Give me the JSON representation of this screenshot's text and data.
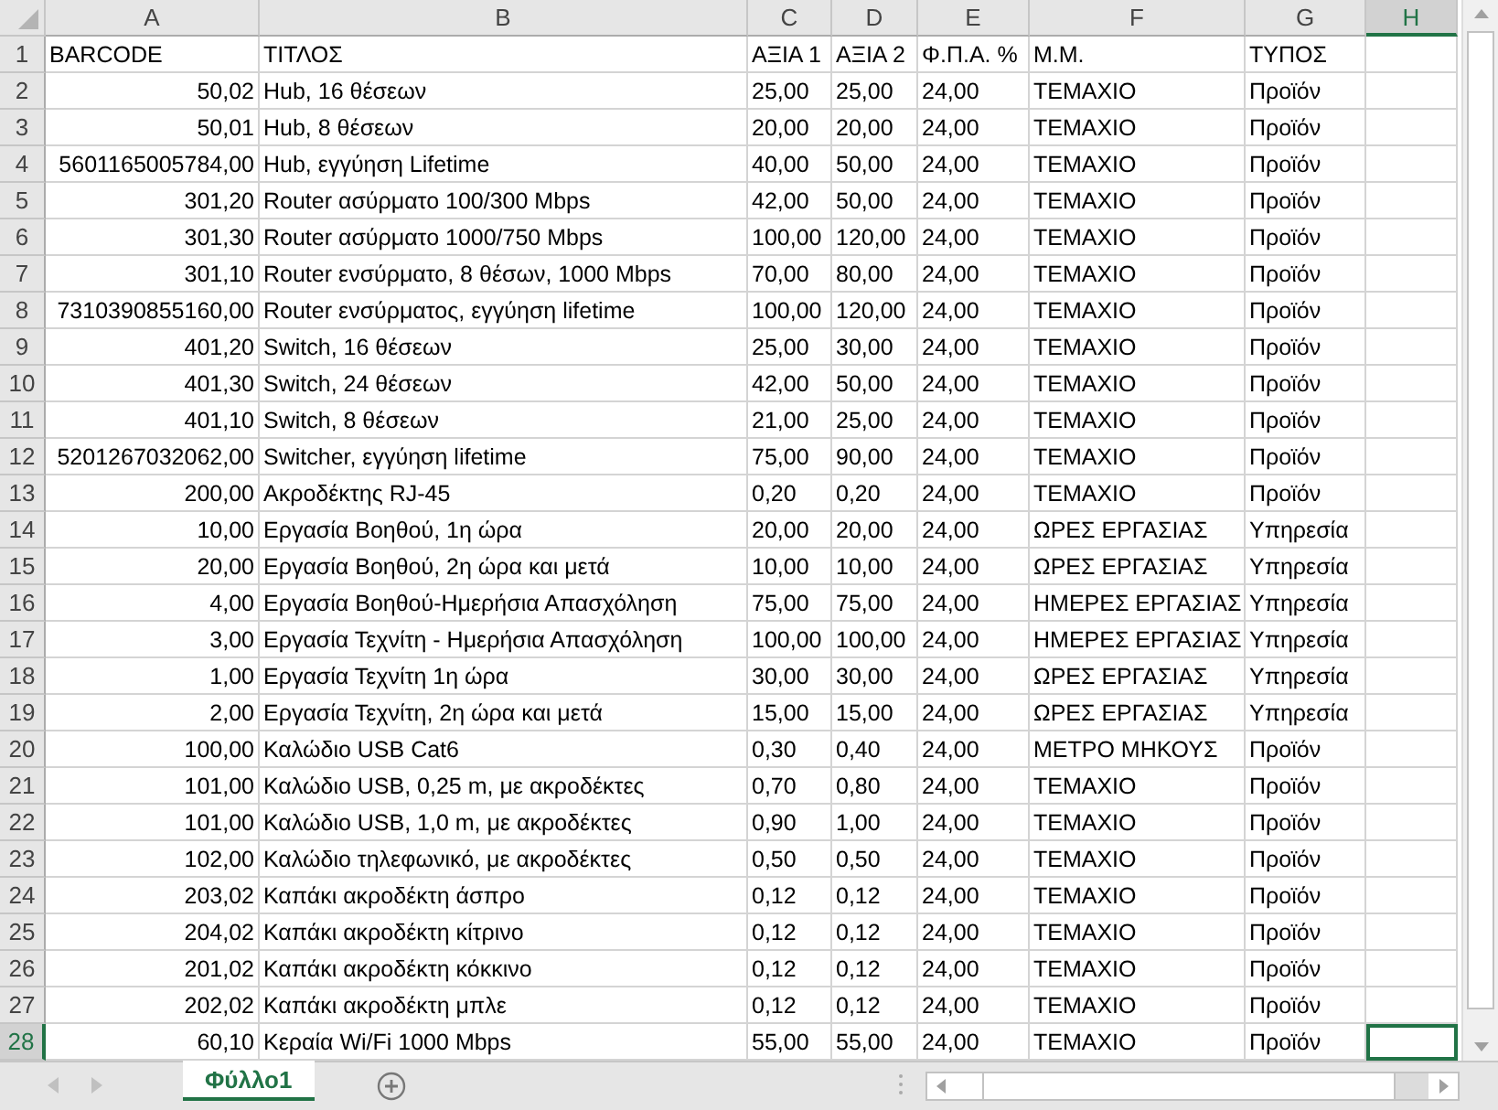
{
  "columns": [
    {
      "letter": "A",
      "selected": false
    },
    {
      "letter": "B",
      "selected": false
    },
    {
      "letter": "C",
      "selected": false
    },
    {
      "letter": "D",
      "selected": false
    },
    {
      "letter": "E",
      "selected": false
    },
    {
      "letter": "F",
      "selected": false
    },
    {
      "letter": "G",
      "selected": false
    },
    {
      "letter": "H",
      "selected": true
    }
  ],
  "rows": [
    {
      "number": "1",
      "selected": false,
      "cells": [
        "BARCODE",
        "ΤΙΤΛΟΣ",
        "ΑΞΙΑ 1",
        "ΑΞΙΑ 2",
        "Φ.Π.Α. %",
        "Μ.Μ.",
        "ΤΥΠΟΣ"
      ]
    },
    {
      "number": "2",
      "selected": false,
      "cells": [
        "50,02",
        "Hub, 16 θέσεων",
        "25,00",
        "25,00",
        "24,00",
        "ΤΕΜΑΧΙΟ",
        "Προϊόν"
      ]
    },
    {
      "number": "3",
      "selected": false,
      "cells": [
        "50,01",
        "Hub, 8 θέσεων",
        "20,00",
        "20,00",
        "24,00",
        "ΤΕΜΑΧΙΟ",
        "Προϊόν"
      ]
    },
    {
      "number": "4",
      "selected": false,
      "cells": [
        "5601165005784,00",
        "Hub, εγγύηση Lifetime",
        "40,00",
        "50,00",
        "24,00",
        "ΤΕΜΑΧΙΟ",
        "Προϊόν"
      ]
    },
    {
      "number": "5",
      "selected": false,
      "cells": [
        "301,20",
        "Router ασύρματο 100/300 Mbps",
        "42,00",
        "50,00",
        "24,00",
        "ΤΕΜΑΧΙΟ",
        "Προϊόν"
      ]
    },
    {
      "number": "6",
      "selected": false,
      "cells": [
        "301,30",
        "Router ασύρματο 1000/750 Mbps",
        "100,00",
        "120,00",
        "24,00",
        "ΤΕΜΑΧΙΟ",
        "Προϊόν"
      ]
    },
    {
      "number": "7",
      "selected": false,
      "cells": [
        "301,10",
        "Router ενσύρματο, 8 θέσων, 1000 Mbps",
        "70,00",
        "80,00",
        "24,00",
        "ΤΕΜΑΧΙΟ",
        "Προϊόν"
      ]
    },
    {
      "number": "8",
      "selected": false,
      "cells": [
        "7310390855160,00",
        "Router ενσύρματος, εγγύηση lifetime",
        "100,00",
        "120,00",
        "24,00",
        "ΤΕΜΑΧΙΟ",
        "Προϊόν"
      ]
    },
    {
      "number": "9",
      "selected": false,
      "cells": [
        "401,20",
        "Switch, 16 θέσεων",
        "25,00",
        "30,00",
        "24,00",
        "ΤΕΜΑΧΙΟ",
        "Προϊόν"
      ]
    },
    {
      "number": "10",
      "selected": false,
      "cells": [
        "401,30",
        "Switch, 24 θέσεων",
        "42,00",
        "50,00",
        "24,00",
        "ΤΕΜΑΧΙΟ",
        "Προϊόν"
      ]
    },
    {
      "number": "11",
      "selected": false,
      "cells": [
        "401,10",
        "Switch, 8 θέσεων",
        "21,00",
        "25,00",
        "24,00",
        "ΤΕΜΑΧΙΟ",
        "Προϊόν"
      ]
    },
    {
      "number": "12",
      "selected": false,
      "cells": [
        "5201267032062,00",
        "Switcher, εγγύηση lifetime",
        "75,00",
        "90,00",
        "24,00",
        "ΤΕΜΑΧΙΟ",
        "Προϊόν"
      ]
    },
    {
      "number": "13",
      "selected": false,
      "cells": [
        "200,00",
        "Ακροδέκτης RJ-45",
        "0,20",
        "0,20",
        "24,00",
        "ΤΕΜΑΧΙΟ",
        "Προϊόν"
      ]
    },
    {
      "number": "14",
      "selected": false,
      "cells": [
        "10,00",
        "Εργασία Βοηθού, 1η ώρα",
        "20,00",
        "20,00",
        "24,00",
        "ΩΡΕΣ ΕΡΓΑΣΙΑΣ",
        "Υπηρεσία"
      ]
    },
    {
      "number": "15",
      "selected": false,
      "cells": [
        "20,00",
        "Εργασία Βοηθού, 2η ώρα και μετά",
        "10,00",
        "10,00",
        "24,00",
        "ΩΡΕΣ ΕΡΓΑΣΙΑΣ",
        "Υπηρεσία"
      ]
    },
    {
      "number": "16",
      "selected": false,
      "cells": [
        "4,00",
        "Εργασία Βοηθού-Ημερήσια Απασχόληση",
        "75,00",
        "75,00",
        "24,00",
        "ΗΜΕΡΕΣ ΕΡΓΑΣΙΑΣ",
        "Υπηρεσία"
      ]
    },
    {
      "number": "17",
      "selected": false,
      "cells": [
        "3,00",
        "Εργασία Τεχνίτη - Ημερήσια Απασχόληση",
        "100,00",
        "100,00",
        "24,00",
        "ΗΜΕΡΕΣ ΕΡΓΑΣΙΑΣ",
        "Υπηρεσία"
      ]
    },
    {
      "number": "18",
      "selected": false,
      "cells": [
        "1,00",
        "Εργασία Τεχνίτη 1η ώρα",
        "30,00",
        "30,00",
        "24,00",
        "ΩΡΕΣ ΕΡΓΑΣΙΑΣ",
        "Υπηρεσία"
      ]
    },
    {
      "number": "19",
      "selected": false,
      "cells": [
        "2,00",
        "Εργασία Τεχνίτη, 2η ώρα και μετά",
        "15,00",
        "15,00",
        "24,00",
        "ΩΡΕΣ ΕΡΓΑΣΙΑΣ",
        "Υπηρεσία"
      ]
    },
    {
      "number": "20",
      "selected": false,
      "cells": [
        "100,00",
        "Καλώδιο USB Cat6",
        "0,30",
        "0,40",
        "24,00",
        "ΜΕΤΡΟ ΜΗΚΟΥΣ",
        "Προϊόν"
      ]
    },
    {
      "number": "21",
      "selected": false,
      "cells": [
        "101,00",
        "Καλώδιο USB, 0,25 m, με ακροδέκτες",
        "0,70",
        "0,80",
        "24,00",
        "ΤΕΜΑΧΙΟ",
        "Προϊόν"
      ]
    },
    {
      "number": "22",
      "selected": false,
      "cells": [
        "101,00",
        "Καλώδιο USB, 1,0 m, με ακροδέκτες",
        "0,90",
        "1,00",
        "24,00",
        "ΤΕΜΑΧΙΟ",
        "Προϊόν"
      ]
    },
    {
      "number": "23",
      "selected": false,
      "cells": [
        "102,00",
        "Καλώδιο τηλεφωνικό, με ακροδέκτες",
        "0,50",
        "0,50",
        "24,00",
        "ΤΕΜΑΧΙΟ",
        "Προϊόν"
      ]
    },
    {
      "number": "24",
      "selected": false,
      "cells": [
        "203,02",
        "Καπάκι ακροδέκτη άσπρο",
        "0,12",
        "0,12",
        "24,00",
        "ΤΕΜΑΧΙΟ",
        "Προϊόν"
      ]
    },
    {
      "number": "25",
      "selected": false,
      "cells": [
        "204,02",
        "Καπάκι ακροδέκτη κίτρινο",
        "0,12",
        "0,12",
        "24,00",
        "ΤΕΜΑΧΙΟ",
        "Προϊόν"
      ]
    },
    {
      "number": "26",
      "selected": false,
      "cells": [
        "201,02",
        "Καπάκι ακροδέκτη κόκκινο",
        "0,12",
        "0,12",
        "24,00",
        "ΤΕΜΑΧΙΟ",
        "Προϊόν"
      ]
    },
    {
      "number": "27",
      "selected": false,
      "cells": [
        "202,02",
        "Καπάκι ακροδέκτη μπλε",
        "0,12",
        "0,12",
        "24,00",
        "ΤΕΜΑΧΙΟ",
        "Προϊόν"
      ]
    },
    {
      "number": "28",
      "selected": true,
      "cells": [
        "60,10",
        "Κεραία Wi/Fi 1000 Mbps",
        "55,00",
        "55,00",
        "24,00",
        "ΤΕΜΑΧΙΟ",
        "Προϊόν"
      ]
    }
  ],
  "sheet_tabs": [
    {
      "label": "Φύλλο1",
      "selected": true
    }
  ]
}
